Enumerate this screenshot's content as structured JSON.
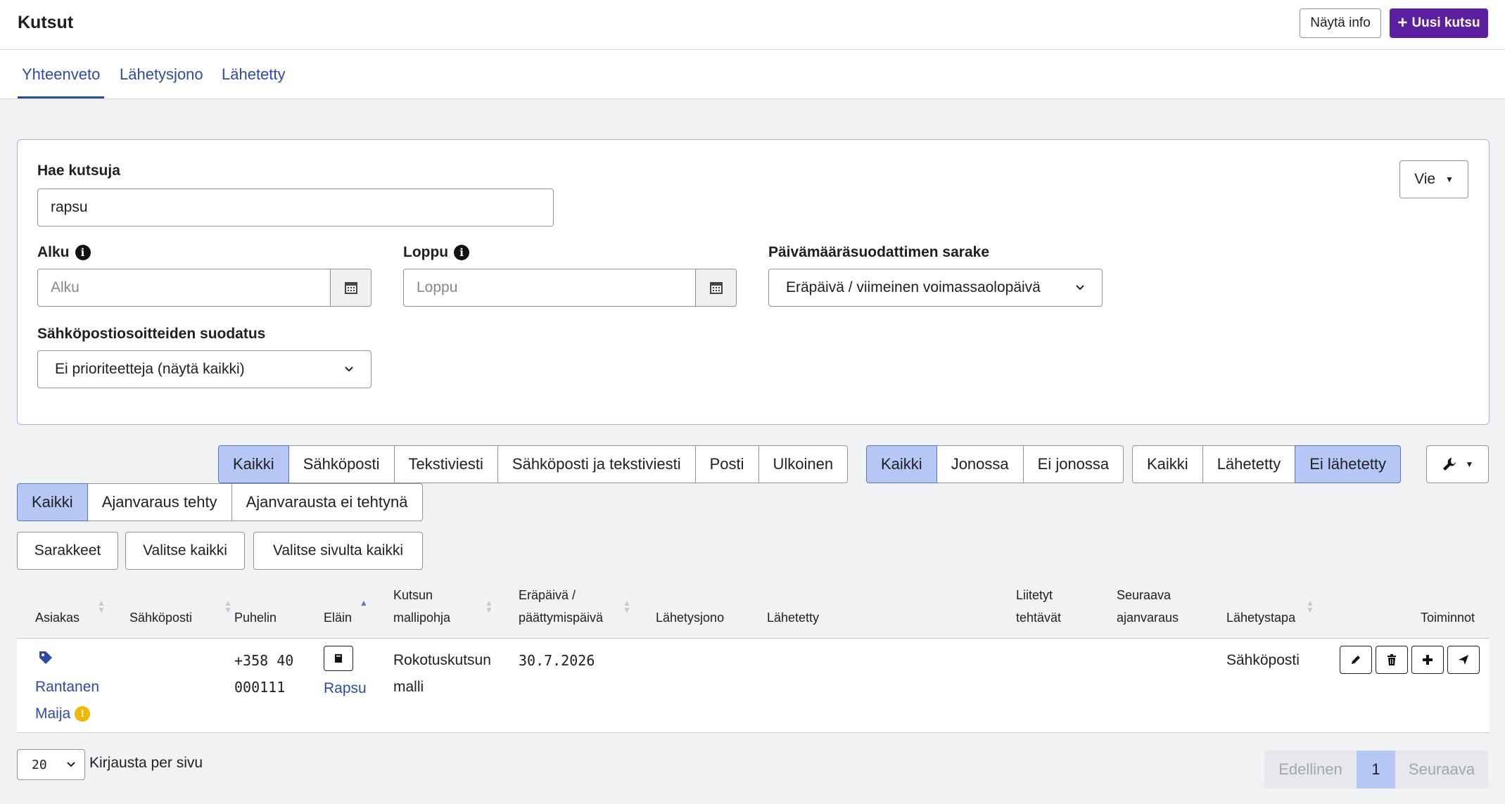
{
  "header": {
    "title": "Kutsut",
    "info_label": "Näytä info",
    "new_label": "Uusi kutsu"
  },
  "tabs": [
    {
      "label": "Yhteenveto",
      "active": true
    },
    {
      "label": "Lähetysjono",
      "active": false
    },
    {
      "label": "Lähetetty",
      "active": false
    }
  ],
  "search": {
    "label": "Hae kutsuja",
    "value": "rapsu",
    "export_label": "Vie",
    "start_label": "Alku",
    "start_placeholder": "Alku",
    "end_label": "Loppu",
    "end_placeholder": "Loppu",
    "date_column_label": "Päivämääräsuodattimen sarake",
    "date_column_value": "Eräpäivä / viimeinen voimassaolopäivä",
    "email_filter_label": "Sähköpostiosoitteiden suodatus",
    "email_filter_value": "Ei prioriteetteja (näytä kaikki)"
  },
  "filters": {
    "channel": [
      "Kaikki",
      "Sähköposti",
      "Tekstiviesti",
      "Sähköposti ja tekstiviesti",
      "Posti",
      "Ulkoinen"
    ],
    "channel_active": 0,
    "queue": [
      "Kaikki",
      "Jonossa",
      "Ei jonossa"
    ],
    "queue_active": 0,
    "sent": [
      "Kaikki",
      "Lähetetty",
      "Ei lähetetty"
    ],
    "sent_active": 2,
    "booking": [
      "Kaikki",
      "Ajanvaraus tehty",
      "Ajanvarausta ei tehtynä"
    ],
    "booking_active": 0
  },
  "actions": {
    "columns_label": "Sarakkeet",
    "select_all_label": "Valitse kaikki",
    "select_page_label": "Valitse sivulta kaikki"
  },
  "table": {
    "headers": {
      "client": "Asiakas",
      "email": "Sähköposti",
      "phone": "Puhelin",
      "animal": "Eläin",
      "template_1": "Kutsun",
      "template_2": "mallipohja",
      "due_1": "Eräpäivä /",
      "due_2": "päättymispäivä",
      "queue": "Lähetysjono",
      "sent": "Lähetetty",
      "tasks_1": "Liitetyt",
      "tasks_2": "tehtävät",
      "next_1": "Seuraava",
      "next_2": "ajanvaraus",
      "method": "Lähetystapa",
      "actions": "Toiminnot"
    },
    "rows": [
      {
        "client_1": "Rantanen",
        "client_2": "Maija",
        "phone_1": "+358 40",
        "phone_2": "000111",
        "animal": "Rapsu",
        "template_1": "Rokotuskutsun",
        "template_2": "malli",
        "due": "30.7.2026",
        "method": "Sähköposti"
      }
    ]
  },
  "pagination": {
    "per_page_value": "20",
    "per_page_label": "Kirjausta per sivu",
    "prev_label": "Edellinen",
    "current_page": "1",
    "next_label": "Seuraava"
  },
  "colors": {
    "accent": "#5b1fa0",
    "link": "#2e4aa6",
    "active_segment": "#b7c7f5",
    "warning": "#f2b705"
  }
}
